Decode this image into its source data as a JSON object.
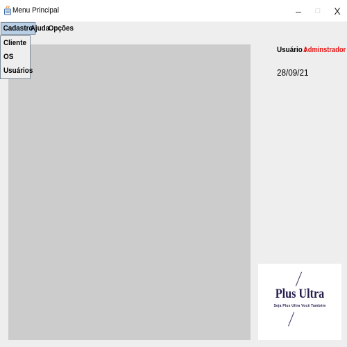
{
  "window": {
    "title": "Menu Principal",
    "minimize": "–",
    "maximize": "□",
    "close": "X"
  },
  "menubar": {
    "menus": [
      "Cadastro",
      "Ajuda",
      "Opções"
    ]
  },
  "dropdown": {
    "items": [
      "Cliente",
      "OS",
      "Usuários"
    ]
  },
  "info": {
    "user_label": "Usuário :",
    "user_value": "Adminstrador",
    "date": "28/09/21"
  },
  "logo": {
    "title": "Plus Ultra",
    "subtitle": "Seja Plus Ultra Você Também"
  },
  "colors": {
    "user_value": "#e81313",
    "active_menu": "#b8cfe5",
    "desktop_pane": "#cccccc",
    "logo_text": "#241c4a"
  }
}
